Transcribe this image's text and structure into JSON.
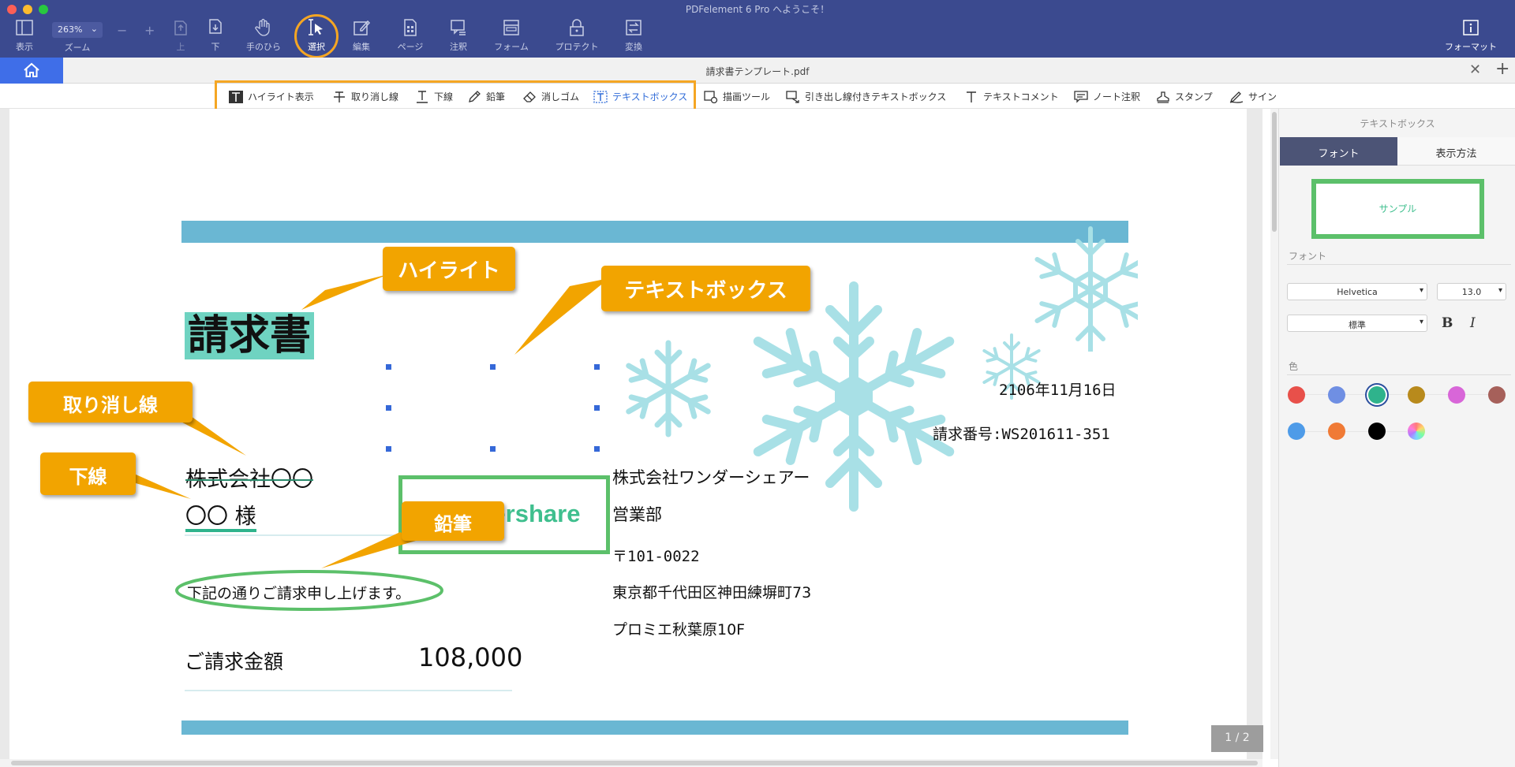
{
  "window": {
    "title": "PDFelement 6 Pro へようこそ！",
    "traffic_colors": [
      "#fc5f57",
      "#fdbb2e",
      "#28c840"
    ]
  },
  "toolbar": {
    "view_label": "表示",
    "zoom_value": "263%",
    "zoom_label": "ズーム",
    "zoom_minus": "−",
    "zoom_plus": "+",
    "up_label": "上",
    "down_label": "下",
    "hand_label": "手のひら",
    "select_label": "選択",
    "edit_label": "編集",
    "page_label": "ページ",
    "comment_label": "注釈",
    "form_label": "フォーム",
    "protect_label": "プロテクト",
    "convert_label": "変換",
    "format_label": "フォーマット"
  },
  "tabs": {
    "document_title": "請求書テンプレート.pdf",
    "close_symbol": "✕",
    "add_symbol": "+"
  },
  "annotation_toolbar": {
    "items": [
      {
        "label": "ハイライト表示",
        "icon": "highlight-icon"
      },
      {
        "label": "取り消し線",
        "icon": "strikethrough-icon"
      },
      {
        "label": "下線",
        "icon": "underline-icon"
      },
      {
        "label": "鉛筆",
        "icon": "pencil-icon"
      },
      {
        "label": "消しゴム",
        "icon": "eraser-icon"
      },
      {
        "label": "テキストボックス",
        "icon": "textbox-icon"
      },
      {
        "label": "描画ツール",
        "icon": "drawing-tool-icon"
      },
      {
        "label": "引き出し線付きテキストボックス",
        "icon": "callout-textbox-icon"
      },
      {
        "label": "テキストコメント",
        "icon": "text-comment-icon"
      },
      {
        "label": "ノート注釈",
        "icon": "note-icon"
      },
      {
        "label": "スタンプ",
        "icon": "stamp-icon"
      },
      {
        "label": "サイン",
        "icon": "signature-icon"
      }
    ],
    "active_index": 5
  },
  "document": {
    "title": "請求書",
    "date": "2106年11月16日",
    "invoice_number": "請求番号:WS201611-351",
    "recipient_company": "株式会社〇〇",
    "recipient_name": "〇〇 様",
    "message": "下記の通りご請求申し上げます。",
    "amount_label": "ご請求金額",
    "amount_value": "108,000",
    "sender_company": "株式会社ワンダーシェアー",
    "sender_department": "営業部",
    "sender_postal": "〒101-0022",
    "sender_address": "東京都千代田区神田練塀町73",
    "sender_building": "プロミエ秋葉原10F",
    "textbox_content": "wondershare",
    "page_indicator": "1 / 2",
    "band_color": "#6ab7d3",
    "snowflake_color": "#a8e0e6"
  },
  "callouts": {
    "highlight": "ハイライト",
    "textbox": "テキストボックス",
    "strikethrough": "取り消し線",
    "underline": "下線",
    "pencil": "鉛筆",
    "fill_color": "#f2a400"
  },
  "properties_panel": {
    "title": "テキストボックス",
    "tab_font": "フォント",
    "tab_display": "表示方法",
    "sample_text": "サンプル",
    "font_section_label": "フォント",
    "font_family": "Helvetica",
    "font_size": "13.0",
    "font_style": "標準",
    "bold_label": "B",
    "italic_label": "I",
    "color_section_label": "色",
    "colors_row1": [
      "#e8504a",
      "#6f8fe3",
      "#2fb38c",
      "#b88a1c",
      "#d866d8",
      "#a6605a"
    ],
    "colors_row2": [
      "#4e9be8",
      "#f07a35",
      "#000000"
    ],
    "selected_color_index": 2
  }
}
